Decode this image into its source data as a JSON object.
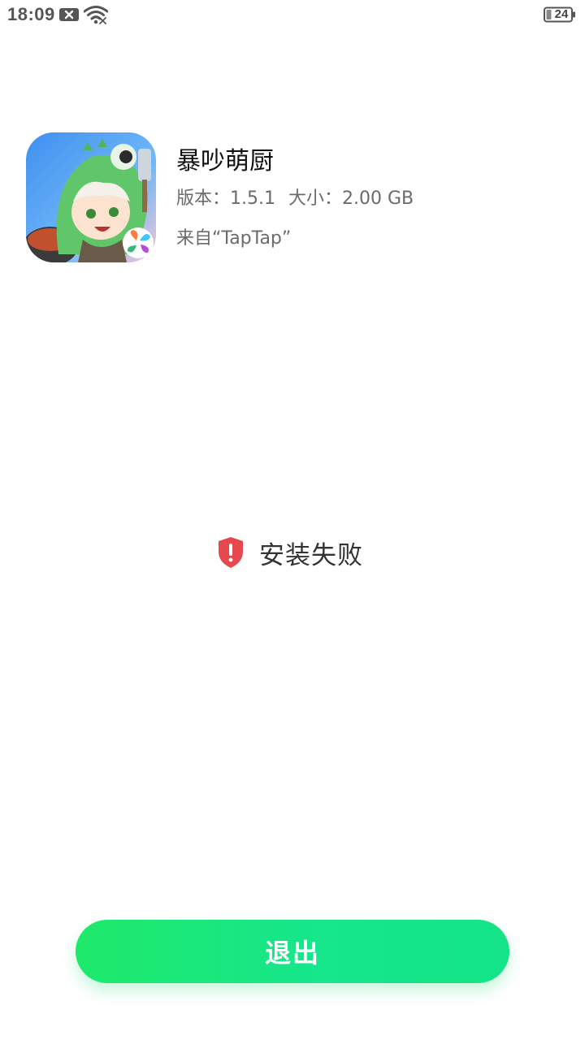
{
  "status_bar": {
    "time": "18:09",
    "battery": "24",
    "icons": [
      "notification-x-icon",
      "wifi-icon",
      "battery-icon"
    ]
  },
  "app": {
    "name": "暴吵萌厨",
    "version_label": "版本：1.5.1",
    "size_label": "大小：2.00 GB",
    "source_label": "来自“TapTap”",
    "icon": "game-app-icon"
  },
  "result": {
    "icon": "shield-alert-icon",
    "text": "安装失败",
    "color": "#e5484d"
  },
  "actions": {
    "exit_label": "退出",
    "accent": "#1ee96a"
  }
}
